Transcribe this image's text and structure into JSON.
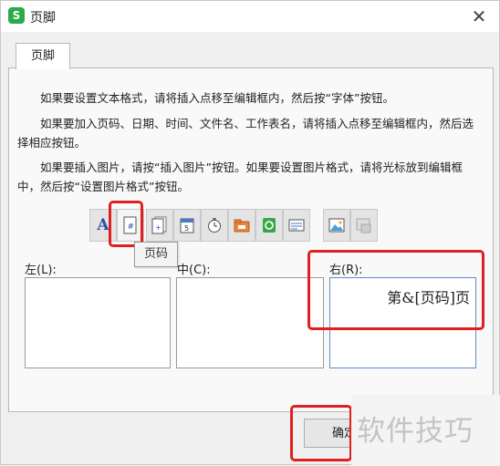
{
  "window": {
    "title": "页脚",
    "app_icon_letter": "S",
    "close_glyph": "✕"
  },
  "tab": {
    "label": "页脚"
  },
  "instructions": [
    "如果要设置文本格式，请将插入点移至编辑框内，然后按“字体”按钮。",
    "如果要加入页码、日期、时间、文件名、工作表名，请将插入点移至编辑框内，然后选择相应按钮。",
    "如果要插入图片，请按“插入图片”按钮。如果要设置图片格式，请将光标放到编辑框中，然后按“设置图片格式”按钮。"
  ],
  "toolbar": {
    "font_glyph": "A",
    "tooltip": "页码"
  },
  "sections": {
    "left_label": "左(L):",
    "center_label": "中(C):",
    "right_label": "右(R):",
    "right_content": "第&[页码]页"
  },
  "footer": {
    "ok_label": "确定"
  },
  "watermark": "软件技巧",
  "colors": {
    "highlight": "#e02020",
    "app_icon": "#2aa84a"
  }
}
